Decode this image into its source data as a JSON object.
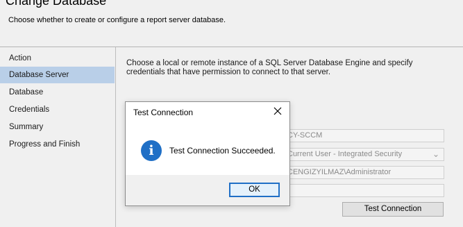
{
  "header": {
    "title": "Change Database",
    "description": "Choose whether to create or configure a report server database."
  },
  "steps": [
    {
      "label": "Action"
    },
    {
      "label": "Database Server"
    },
    {
      "label": "Database"
    },
    {
      "label": "Credentials"
    },
    {
      "label": "Summary"
    },
    {
      "label": "Progress and Finish"
    }
  ],
  "content": {
    "description": "Choose a local or remote instance of a SQL Server Database Engine and specify credentials that have permission to connect to that server.",
    "server_value": "CY-SCCM",
    "auth_value": "Current User - Integrated Security",
    "username_value": "CENGIZYILMAZ\\Administrator",
    "password_value": "",
    "test_button": "Test Connection"
  },
  "dialog": {
    "title": "Test Connection",
    "message": "Test Connection Succeeded.",
    "ok_label": "OK",
    "icon": "info-icon",
    "close_icon": "close-icon"
  },
  "colors": {
    "accent": "#1f6fc6",
    "selected_step": "#b9cfe8",
    "panel": "#f0f0f0"
  }
}
